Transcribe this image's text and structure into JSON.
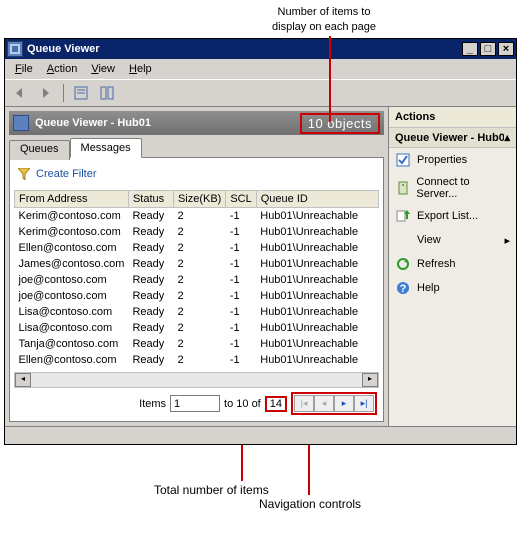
{
  "annotations": {
    "top1": "Number of items to",
    "top2": "display on each page",
    "bottom1": "Total number of items",
    "bottom2": "Navigation controls"
  },
  "window": {
    "title": "Queue Viewer",
    "min": "_",
    "max": "□",
    "close": "×"
  },
  "menu": {
    "file": "File",
    "action": "Action",
    "view": "View",
    "help": "Help"
  },
  "panel": {
    "title": "Queue Viewer - Hub01",
    "count": "10 objects"
  },
  "tabs": {
    "queues": "Queues",
    "messages": "Messages"
  },
  "filter": "Create Filter",
  "columns": {
    "from": "From Address",
    "status": "Status",
    "size": "Size(KB)",
    "scl": "SCL",
    "qid": "Queue ID"
  },
  "rows": [
    {
      "from": "Kerim@contoso.com",
      "status": "Ready",
      "size": "2",
      "scl": "-1",
      "qid": "Hub01\\Unreachable"
    },
    {
      "from": "Kerim@contoso.com",
      "status": "Ready",
      "size": "2",
      "scl": "-1",
      "qid": "Hub01\\Unreachable"
    },
    {
      "from": "Ellen@contoso.com",
      "status": "Ready",
      "size": "2",
      "scl": "-1",
      "qid": "Hub01\\Unreachable"
    },
    {
      "from": "James@contoso.com",
      "status": "Ready",
      "size": "2",
      "scl": "-1",
      "qid": "Hub01\\Unreachable"
    },
    {
      "from": "joe@contoso.com",
      "status": "Ready",
      "size": "2",
      "scl": "-1",
      "qid": "Hub01\\Unreachable"
    },
    {
      "from": "joe@contoso.com",
      "status": "Ready",
      "size": "2",
      "scl": "-1",
      "qid": "Hub01\\Unreachable"
    },
    {
      "from": "Lisa@contoso.com",
      "status": "Ready",
      "size": "2",
      "scl": "-1",
      "qid": "Hub01\\Unreachable"
    },
    {
      "from": "Lisa@contoso.com",
      "status": "Ready",
      "size": "2",
      "scl": "-1",
      "qid": "Hub01\\Unreachable"
    },
    {
      "from": "Tanja@contoso.com",
      "status": "Ready",
      "size": "2",
      "scl": "-1",
      "qid": "Hub01\\Unreachable"
    },
    {
      "from": "Ellen@contoso.com",
      "status": "Ready",
      "size": "2",
      "scl": "-1",
      "qid": "Hub01\\Unreachable"
    }
  ],
  "pager": {
    "label": "Items",
    "value": "1",
    "to": "to 10 of",
    "total": "14"
  },
  "actions": {
    "header": "Actions",
    "sub": "Queue Viewer - Hub01",
    "items": [
      {
        "label": "Properties"
      },
      {
        "label": "Connect to Server..."
      },
      {
        "label": "Export List..."
      },
      {
        "label": "View"
      },
      {
        "label": "Refresh"
      },
      {
        "label": "Help"
      }
    ]
  }
}
